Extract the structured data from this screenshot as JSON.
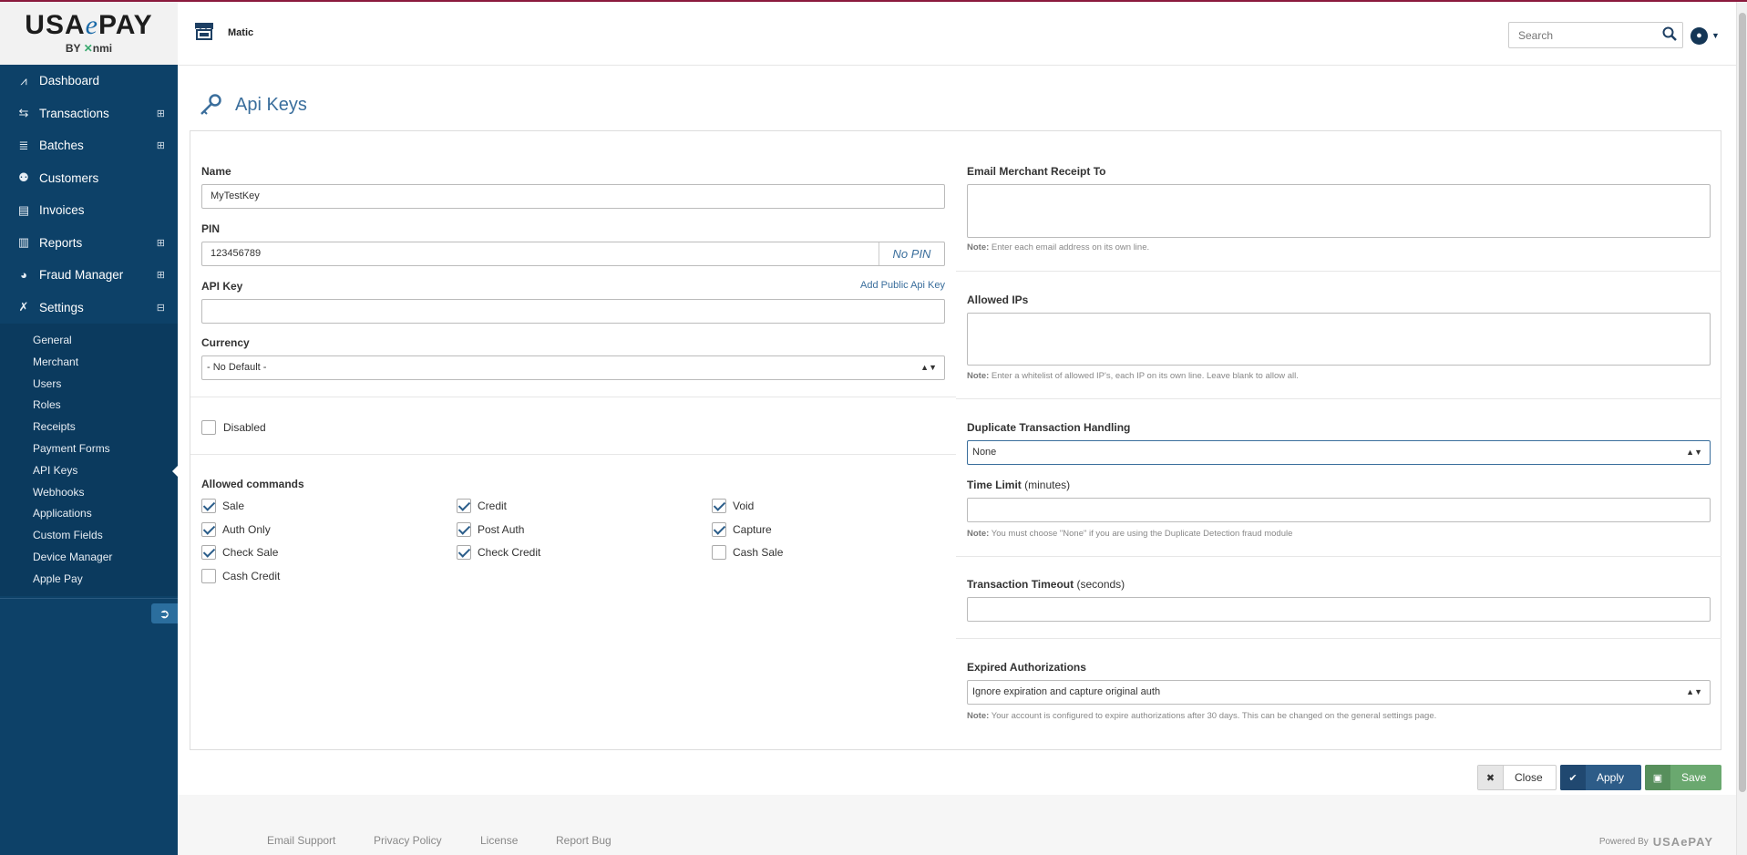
{
  "logo": {
    "brand_left": "USA",
    "brand_e": "e",
    "brand_right": "PAY",
    "by_left": "BY ",
    "by_x": "✕",
    "by_right": "nmi"
  },
  "header": {
    "merchant": "Matic",
    "search_placeholder": "Search"
  },
  "sidebar": {
    "items": [
      {
        "label": "Dashboard",
        "icon": "chart-icon",
        "expandable": false
      },
      {
        "label": "Transactions",
        "icon": "arrows-icon",
        "expandable": true
      },
      {
        "label": "Batches",
        "icon": "stack-icon",
        "expandable": true
      },
      {
        "label": "Customers",
        "icon": "users-icon",
        "expandable": false
      },
      {
        "label": "Invoices",
        "icon": "document-icon",
        "expandable": false
      },
      {
        "label": "Reports",
        "icon": "bar-chart-icon",
        "expandable": true
      },
      {
        "label": "Fraud Manager",
        "icon": "globe-icon",
        "expandable": true
      },
      {
        "label": "Settings",
        "icon": "tools-icon",
        "expandable": true
      }
    ],
    "settings_sub": [
      "General",
      "Merchant",
      "Users",
      "Roles",
      "Receipts",
      "Payment Forms",
      "API Keys",
      "Webhooks",
      "Applications",
      "Custom Fields",
      "Device Manager",
      "Apple Pay"
    ]
  },
  "page": {
    "title": "Api Keys"
  },
  "form": {
    "name_label": "Name",
    "name_value": "MyTestKey",
    "pin_label": "PIN",
    "pin_value": "123456789",
    "no_pin": "No PIN",
    "apikey_label": "API Key",
    "apikey_value": "",
    "add_public": "Add Public Api Key",
    "currency_label": "Currency",
    "currency_value": "- No Default -",
    "disabled_label": "Disabled",
    "allowed_label": "Allowed commands",
    "commands": [
      {
        "label": "Sale",
        "checked": true
      },
      {
        "label": "Credit",
        "checked": true
      },
      {
        "label": "Void",
        "checked": true
      },
      {
        "label": "Auth Only",
        "checked": true
      },
      {
        "label": "Post Auth",
        "checked": true
      },
      {
        "label": "Capture",
        "checked": true
      },
      {
        "label": "Check Sale",
        "checked": true
      },
      {
        "label": "Check Credit",
        "checked": true
      },
      {
        "label": "Cash Sale",
        "checked": false
      },
      {
        "label": "Cash Credit",
        "checked": false
      }
    ],
    "email_label": "Email Merchant Receipt To",
    "email_note_b": "Note:",
    "email_note": " Enter each email address on its own line.",
    "ips_label": "Allowed IPs",
    "ips_note_b": "Note:",
    "ips_note": " Enter a whitelist of allowed IP's, each IP on its own line. Leave blank to allow all.",
    "dup_label": "Duplicate Transaction Handling",
    "dup_value": "None",
    "time_label": "Time Limit",
    "time_unit": "(minutes)",
    "time_note_b": "Note:",
    "time_note": " You must choose \"None\" if you are using the Duplicate Detection fraud module",
    "timeout_label": "Transaction Timeout",
    "timeout_unit": "(seconds)",
    "expired_label": "Expired Authorizations",
    "expired_value": "Ignore expiration and capture original auth",
    "expired_note_b": "Note:",
    "expired_note": " Your account is configured to expire authorizations after 30 days. This can be changed on the general settings page."
  },
  "buttons": {
    "close": "Close",
    "apply": "Apply",
    "save": "Save"
  },
  "footer": {
    "links": [
      "Email Support",
      "Privacy Policy",
      "License",
      "Report Bug"
    ],
    "powered": "Powered By",
    "powered_brand": "USAePAY"
  }
}
